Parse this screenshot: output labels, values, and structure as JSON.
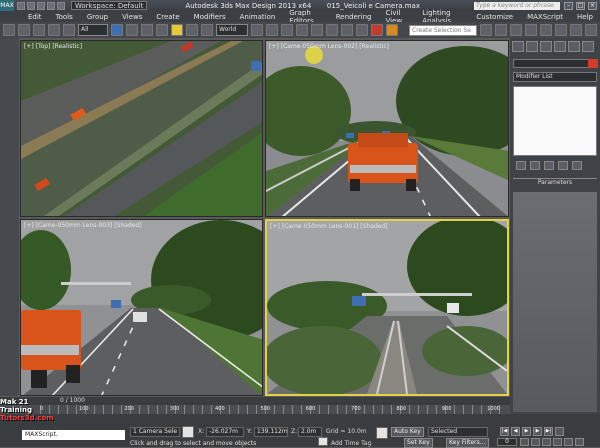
{
  "titlebar": {
    "workspace": "Workspace: Default",
    "app_title": "Autodesk 3ds Max Design 2013 x64",
    "file_name": "015_Veicoli e Camera.max",
    "search_placeholder": "Type a keyword or phrase",
    "logo": "MAX"
  },
  "menu": [
    "Edit",
    "Tools",
    "Group",
    "Views",
    "Create",
    "Modifiers",
    "Animation",
    "Graph Editors",
    "Rendering",
    "Civil View",
    "Lighting Analysis",
    "Customize",
    "MAXScript",
    "Help"
  ],
  "toolbar": {
    "filter": "All",
    "coord": "World",
    "selection_set": "Create Selection Se"
  },
  "viewports": {
    "top": "[+] [Top] [Realistic]",
    "cam1": "[+] [Came-050mm Lens-002] [Realistic]",
    "cam2": "[+] [Came-050mm Lens-003] [Shaded]",
    "cam3": "[+] [Came-050mm Lens-001] [Shaded]"
  },
  "command_panel": {
    "modifier_list": "Modifier List",
    "parameters": "Parameters"
  },
  "timeline": {
    "slider": "0 / 1000",
    "ticks": [
      "0",
      "100",
      "200",
      "300",
      "400",
      "500",
      "600",
      "700",
      "800",
      "900",
      "1000"
    ]
  },
  "status": {
    "watermark_line1": "Mak 21 Training",
    "watermark_line2": "Tutors3d.com",
    "maxscript": "MAXScript.",
    "selection": "1 Camera Sele",
    "x_label": "X:",
    "x_value": "-26.027m",
    "y_label": "Y:",
    "y_value": "139.112m",
    "z_label": "Z:",
    "z_value": "2.0m",
    "grid": "Grid = 10.0m",
    "prompt": "Click and drag to select and move objects",
    "add_time_tag": "Add Time Tag",
    "auto_key": "Auto Key",
    "set_key": "Set Key",
    "selected": "Selected",
    "key_filters": "Key Filters...",
    "frame": "0"
  }
}
